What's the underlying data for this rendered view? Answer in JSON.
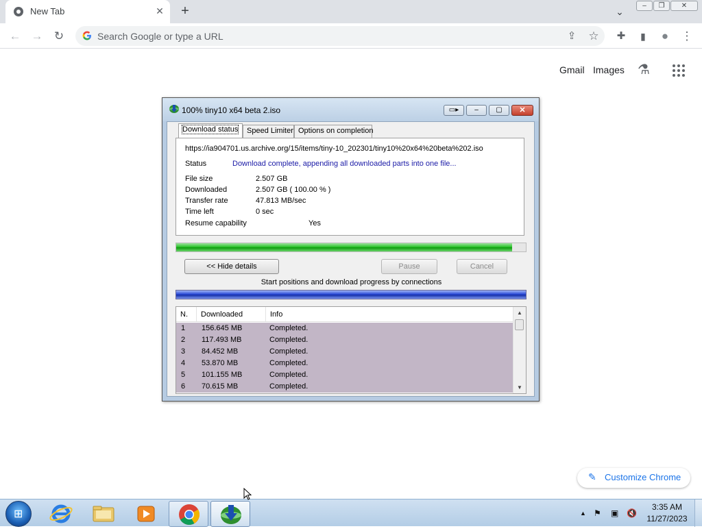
{
  "browser": {
    "tab_title": "New Tab",
    "tab_close": "✕",
    "new_tab": "+",
    "tab_search": "⌄",
    "window_controls": {
      "minimize": "–",
      "restore": "❐",
      "close": "✕"
    },
    "nav": {
      "back": "←",
      "forward": "→",
      "reload": "↻"
    },
    "omnibox_placeholder": "Search Google or type a URL",
    "toolbar_icons": {
      "share": "⇪",
      "bookmark": "☆",
      "extensions": "✚",
      "side_panel": "▮",
      "profile": "●",
      "menu": "⋮"
    }
  },
  "ntp": {
    "gmail": "Gmail",
    "images": "Images",
    "labs_icon": "⚗",
    "apps_icon": "⋮⋮⋮",
    "customize_label": "Customize Chrome",
    "customize_icon": "✎"
  },
  "idm": {
    "title": "100% tiny10 x64 beta 2.iso",
    "controls": {
      "to_tray": "▭▸",
      "minimize": "–",
      "maximize": "▢",
      "close": "✕"
    },
    "tabs": [
      "Download status",
      "Speed Limiter",
      "Options on completion"
    ],
    "url": "https://ia904701.us.archive.org/15/items/tiny-10_202301/tiny10%20x64%20beta%202.iso",
    "status_label": "Status",
    "status_value": "Download complete, appending all downloaded parts into one file...",
    "rows": [
      {
        "label": "File size",
        "value": "2.507  GB"
      },
      {
        "label": "Downloaded",
        "value": "2.507  GB  ( 100.00 % )"
      },
      {
        "label": "Transfer rate",
        "value": "47.813  MB/sec"
      },
      {
        "label": "Time left",
        "value": "0 sec"
      }
    ],
    "resume_label": "Resume capability",
    "resume_value": "Yes",
    "progress_fraction": 0.96,
    "buttons": {
      "hide_details": "<< Hide details",
      "pause": "Pause",
      "cancel": "Cancel"
    },
    "connections_caption": "Start positions and download progress by connections",
    "table": {
      "headers": [
        "N.",
        "Downloaded",
        "Info"
      ],
      "rows": [
        {
          "n": "1",
          "downloaded": "156.645  MB",
          "info": "Completed."
        },
        {
          "n": "2",
          "downloaded": "117.493  MB",
          "info": "Completed."
        },
        {
          "n": "3",
          "downloaded": "84.452  MB",
          "info": "Completed."
        },
        {
          "n": "4",
          "downloaded": "53.870  MB",
          "info": "Completed."
        },
        {
          "n": "5",
          "downloaded": "101.155  MB",
          "info": "Completed."
        },
        {
          "n": "6",
          "downloaded": "70.615  MB",
          "info": "Completed."
        }
      ]
    },
    "scroll_up": "▲",
    "scroll_down": "▼"
  },
  "taskbar": {
    "start_icon": "⊞",
    "tray_icons": {
      "show_hidden": "▲",
      "flag": "⚑",
      "network": "▣",
      "volume": "🔇"
    },
    "time": "3:35 AM",
    "date": "11/27/2023"
  }
}
